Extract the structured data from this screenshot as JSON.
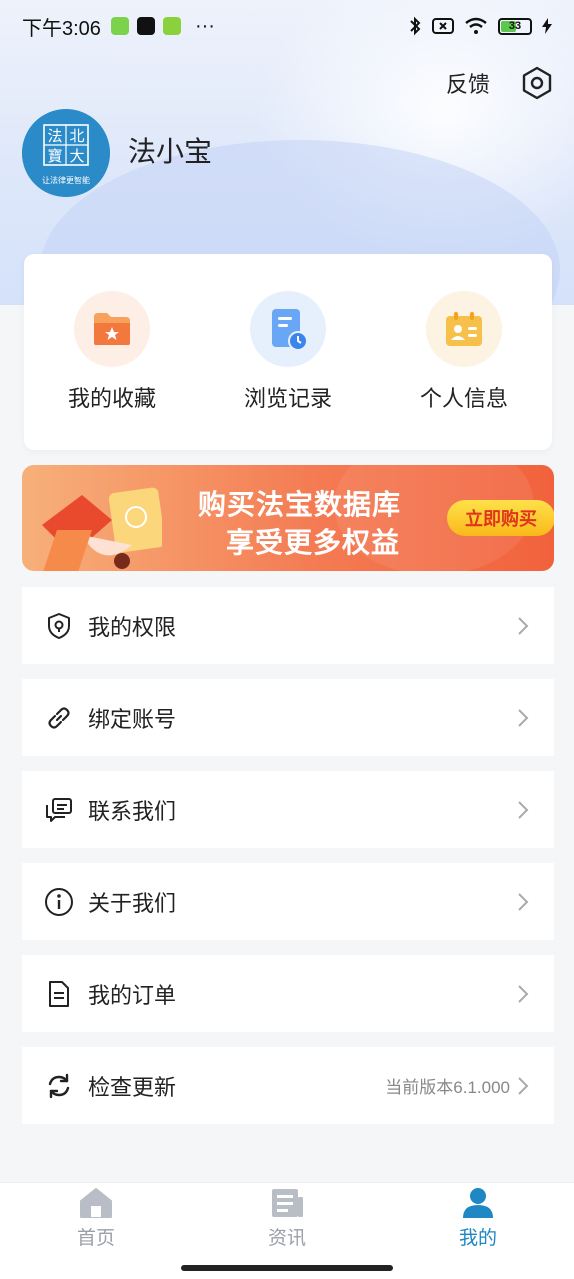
{
  "status_bar": {
    "time": "下午3:06",
    "more": "···",
    "battery": "33"
  },
  "header": {
    "feedback_label": "反馈",
    "username": "法小宝",
    "avatar_text": [
      "北",
      "法",
      "大",
      "寶"
    ],
    "avatar_sub": "让法律更智能"
  },
  "quick_actions": [
    {
      "label": "我的收藏",
      "icon": "folder-star-icon"
    },
    {
      "label": "浏览记录",
      "icon": "document-clock-icon"
    },
    {
      "label": "个人信息",
      "icon": "id-card-icon"
    }
  ],
  "banner": {
    "line1": "购买法宝数据库",
    "line2": "享受更多权益",
    "cta": "立即购买"
  },
  "menu": [
    {
      "label": "我的权限",
      "icon": "shield-lock-icon",
      "value": ""
    },
    {
      "label": "绑定账号",
      "icon": "link-icon",
      "value": ""
    },
    {
      "label": "联系我们",
      "icon": "chat-icon",
      "value": ""
    },
    {
      "label": "关于我们",
      "icon": "info-icon",
      "value": ""
    },
    {
      "label": "我的订单",
      "icon": "order-document-icon",
      "value": ""
    },
    {
      "label": "检查更新",
      "icon": "refresh-icon",
      "value": "当前版本6.1.000"
    }
  ],
  "tabbar": [
    {
      "label": "首页",
      "icon": "home-icon",
      "active": false
    },
    {
      "label": "资讯",
      "icon": "news-icon",
      "active": false
    },
    {
      "label": "我的",
      "icon": "profile-icon",
      "active": true
    }
  ],
  "colors": {
    "accent": "#2b8bc9",
    "banner_orange": "#f47b53",
    "cta_yellow": "#fcd13a"
  }
}
